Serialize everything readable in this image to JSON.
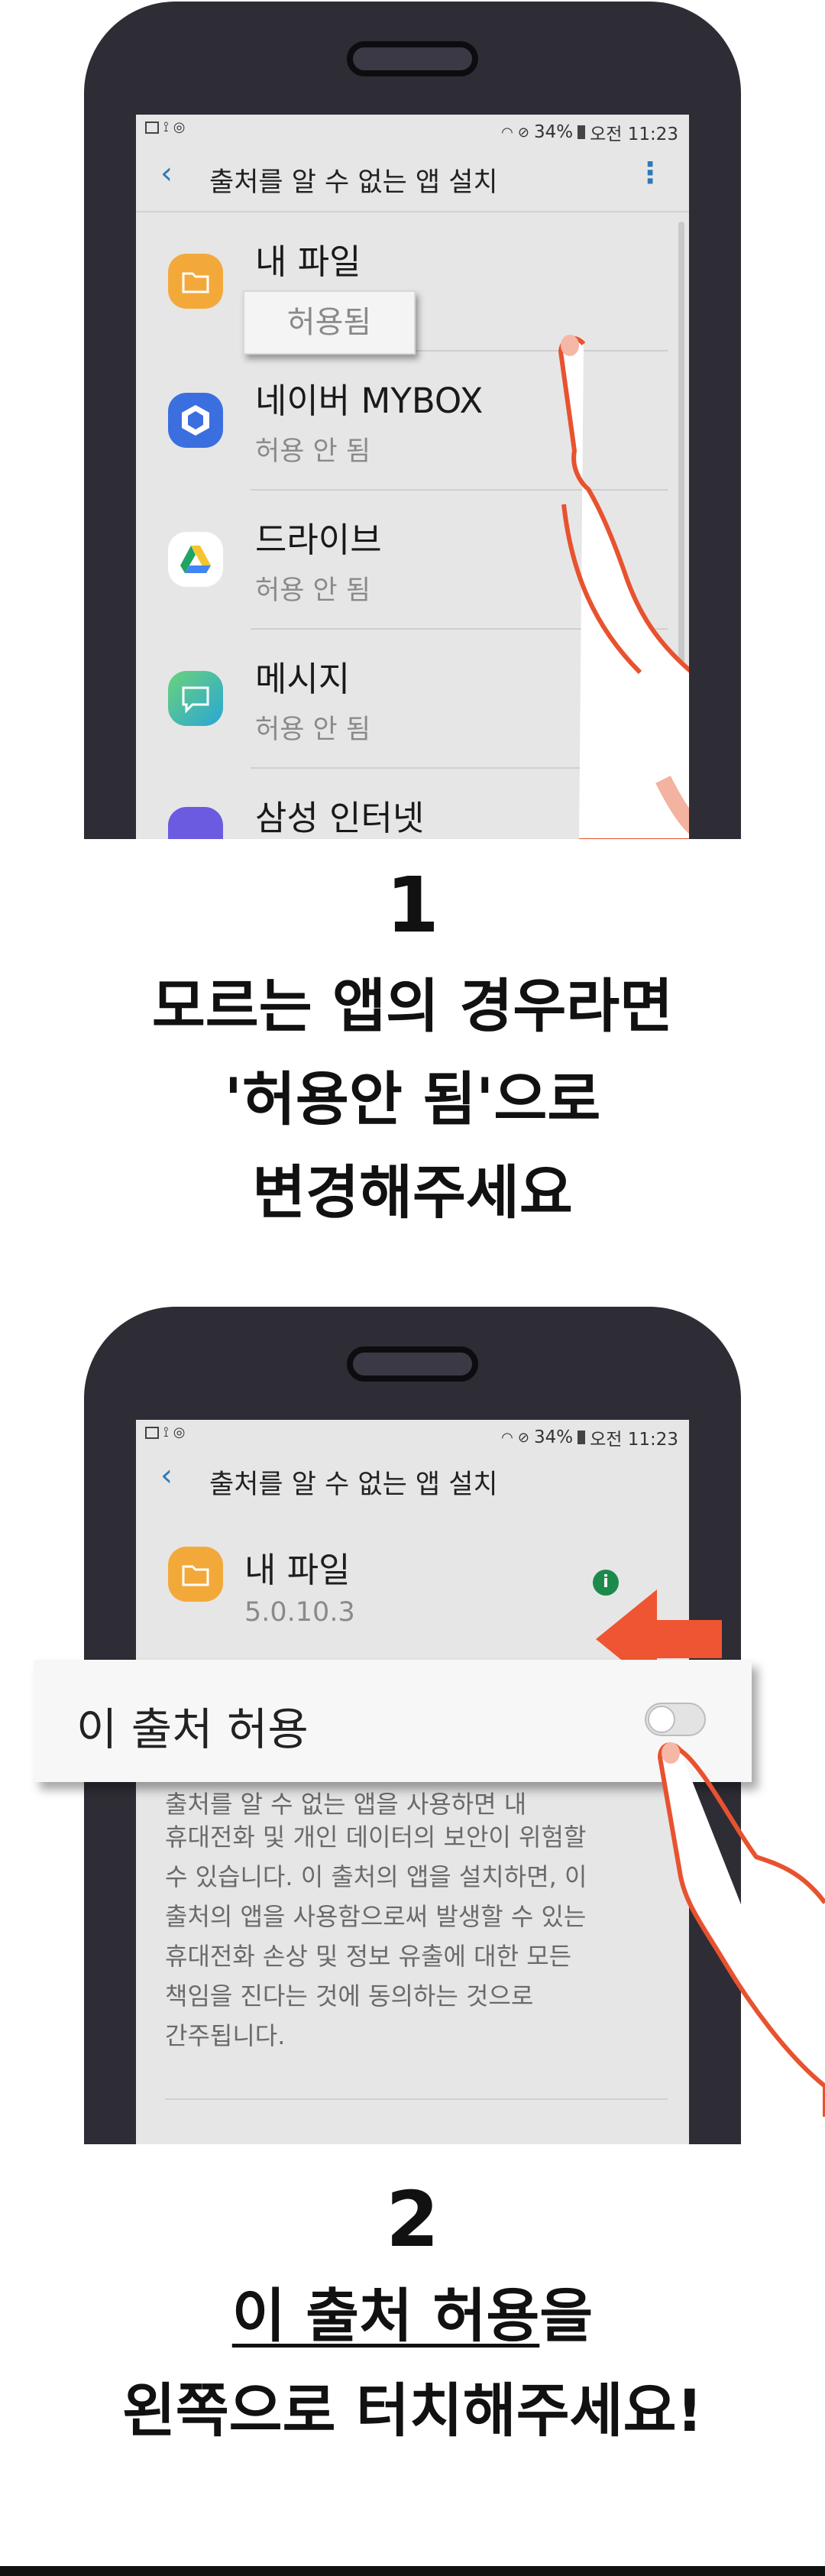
{
  "step1": {
    "status": {
      "left_icons": [
        "image-icon",
        "cast-icon",
        "compass-icon"
      ],
      "battery": "34%",
      "time": "오전 11:23"
    },
    "title": "출처를 알 수 없는 앱 설치",
    "apps": [
      {
        "name": "내 파일",
        "status": "허용됨",
        "icon": "folder-icon",
        "color": "#f3a93a"
      },
      {
        "name": "네이버 MYBOX",
        "status": "허용 안 됨",
        "icon": "cube-icon",
        "color": "#3b6fe0"
      },
      {
        "name": "드라이브",
        "status": "허용 안 됨",
        "icon": "drive-icon",
        "color": "#ffffff"
      },
      {
        "name": "메시지",
        "status": "허용 안 됨",
        "icon": "message-icon",
        "color": "#2dbd9c"
      },
      {
        "name": "삼성 인터넷",
        "status": "",
        "icon": "internet-icon",
        "color": "#6b5be0"
      }
    ],
    "number": "1",
    "caption_lines": [
      "모르는 앱의 경우라면",
      "'허용안 됨'으로",
      "변경해주세요"
    ]
  },
  "step2": {
    "status": {
      "left_icons": [
        "image-icon",
        "cast-icon",
        "compass-icon"
      ],
      "battery": "34%",
      "time": "오전 11:23"
    },
    "title": "출처를 알 수 없는 앱 설치",
    "app_name": "내 파일",
    "app_version": "5.0.10.3",
    "toggle_label": "이 출처 허용",
    "toggle_on": false,
    "warning_top": "출처를 알 수 없는 앱을 사용하면 내",
    "warning_lines": [
      "휴대전화 및 개인 데이터의 보안이 위험할",
      "수 있습니다. 이 출처의 앱을 설치하면, 이",
      "출처의 앱을 사용함으로써 발생할 수 있는",
      "휴대전화 손상 및 정보 유출에 대한 모든",
      "책임을 진다는 것에 동의하는 것으로",
      "간주됩니다."
    ],
    "number": "2",
    "caption_line1_underlined": "이 출처 허용",
    "caption_line1_rest": "을",
    "caption_line2": "왼쪽으로 터치해주세요!"
  },
  "colors": {
    "accent": "#2d79b9",
    "arrow": "#ef5532",
    "hand_outline": "#e8522f",
    "screen": "#e6e6e6",
    "frame": "#2e2d35"
  }
}
